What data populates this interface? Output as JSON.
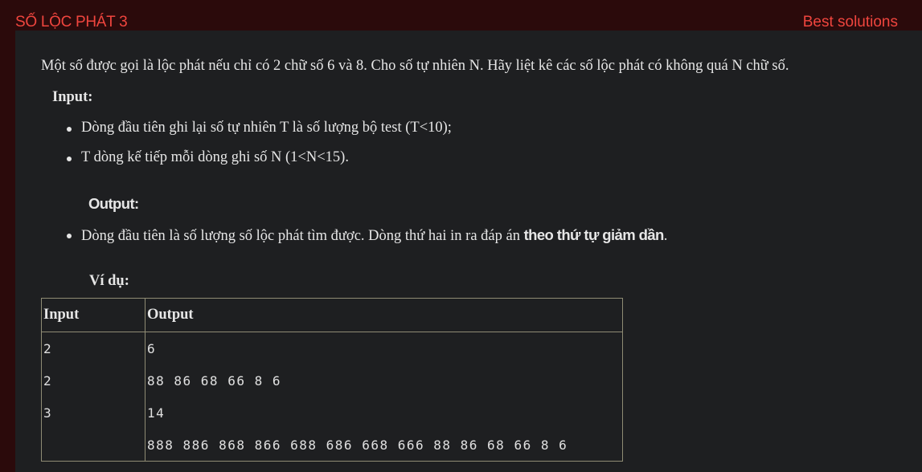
{
  "header": {
    "title": "SỐ LỘC PHÁT 3",
    "best_solutions": "Best solutions"
  },
  "problem": {
    "description": "Một số được gọi là lộc phát nếu chỉ có 2 chữ số 6 và 8. Cho số tự nhiên N. Hãy liệt kê các số lộc phát có không quá N chữ số.",
    "input_heading": "Input:",
    "input_items": [
      "Dòng đầu tiên ghi lại số tự nhiên T là số lượng bộ test (T<10);",
      "T dòng kế tiếp mỗi dòng ghi số N (1<N<15)."
    ],
    "output_heading": "Output:",
    "output_item_prefix": "Dòng đầu tiên là số lượng số lộc phát tìm được. Dòng thứ hai in ra đáp án ",
    "output_item_strong": "theo thứ tự giảm dần",
    "output_item_suffix": ".",
    "example_heading": "Ví dụ:"
  },
  "example_table": {
    "headers": [
      "Input",
      "Output"
    ],
    "rows": [
      [
        "2",
        "6"
      ],
      [
        "2",
        "88 86 68 66 8 6"
      ],
      [
        "3",
        "14"
      ],
      [
        "",
        "888 886 868 866 688 686 668 666 88 86 68 66 8 6"
      ]
    ]
  },
  "colors": {
    "header_bg": "#2b0a0b",
    "accent": "#f0453e",
    "panel_bg": "#1e1f21",
    "text": "#e6e6e6",
    "table_border": "#8f8c74"
  }
}
